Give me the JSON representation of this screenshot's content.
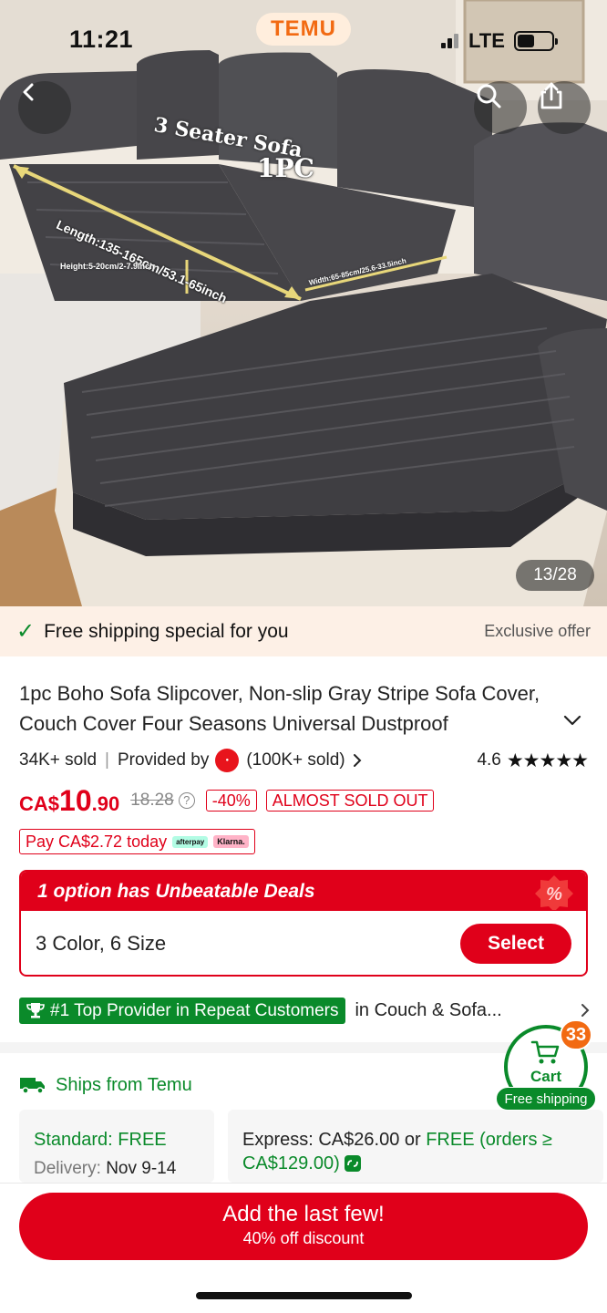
{
  "status_bar": {
    "time": "11:21",
    "brand": "TEMU",
    "network": "LTE"
  },
  "hero": {
    "image_overlay": {
      "heading": "3 Seater Sofa",
      "subheading": "1PC",
      "length": "Length:135-165cm/53.1-65inch",
      "height": "Height:5-20cm/2-7.9inch",
      "width": "Width:65-85cm/25.6-33.5inch"
    },
    "counter": "13/28"
  },
  "shipping_strip": {
    "message": "Free shipping special for you",
    "offer": "Exclusive offer"
  },
  "product": {
    "title": "1pc Boho Sofa Slipcover, Non-slip Gray Stripe Sofa Cover, Couch Cover Four Seasons Universal Dustproof",
    "sold": "34K+ sold",
    "provided_by": "Provided by",
    "store_sold": "(100K+ sold)",
    "rating": "4.6",
    "stars": "★★★★★",
    "price_currency": "CA$",
    "price_int": "10",
    "price_dec": ".90",
    "old_price": "18.28",
    "discount": "-40%",
    "stock_tag": "ALMOST SOLD OUT",
    "pay_today": "Pay CA$2.72 today",
    "afterpay": "afterpay",
    "klarna": "Klarna."
  },
  "deal": {
    "header": "1 option has Unbeatable Deals",
    "options": "3 Color, 6 Size",
    "select": "Select"
  },
  "provider": {
    "badge": "#1 Top Provider in Repeat Customers",
    "category": "in Couch & Sofa..."
  },
  "shipping": {
    "ships_from": "Ships from Temu",
    "standard_label": "Standard: FREE",
    "delivery_label": "Delivery:",
    "delivery_date": "Nov 9-14",
    "express_prefix": "Express: CA$26.00 or",
    "express_free": "FREE (orders ≥",
    "express_min": "CA$129.00)"
  },
  "cart": {
    "label": "Cart",
    "count": "33",
    "free_shipping": "Free shipping"
  },
  "cta": {
    "line1": "Add the last few!",
    "line2": "40% off discount"
  },
  "colors": {
    "accent_red": "#e0001a",
    "green": "#0a8a2a",
    "temu_orange": "#f26a12"
  }
}
